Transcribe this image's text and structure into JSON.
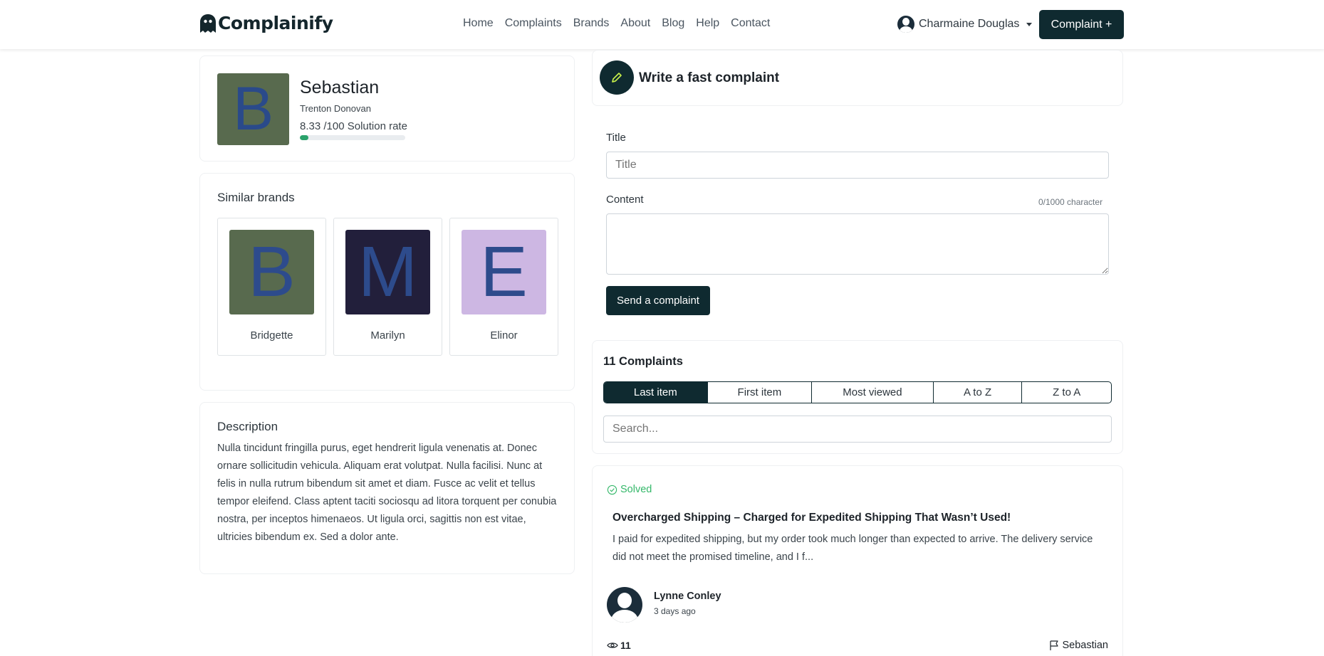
{
  "nav": {
    "logo": "Complainify",
    "links": [
      "Home",
      "Complaints",
      "Brands",
      "About",
      "Blog",
      "Help",
      "Contact"
    ],
    "user": "Charmaine Douglas",
    "cta": "Complaint +"
  },
  "brand": {
    "initial": "B",
    "name": "Sebastian",
    "owner": "Trenton Donovan",
    "rate_text": "8.33 /100 Solution rate",
    "rate_value": 8.33,
    "logo_color": "#586a4e"
  },
  "similar": {
    "title": "Similar brands",
    "items": [
      {
        "initial": "B",
        "name": "Bridgette",
        "color": "#586a4e"
      },
      {
        "initial": "M",
        "name": "Marilyn",
        "color": "#221f3b"
      },
      {
        "initial": "E",
        "name": "Elinor",
        "color": "#cdb7e3"
      }
    ]
  },
  "description": {
    "title": "Description",
    "text": "Nulla tincidunt fringilla purus, eget hendrerit ligula venenatis at. Donec ornare sollicitudin vehicula. Aliquam erat volutpat. Nulla facilisi. Nunc at felis in nulla rutrum bibendum sit amet et diam. Fusce ac velit et tellus tempor eleifend. Class aptent taciti sociosqu ad litora torquent per conubia nostra, per inceptos himenaeos. Ut ligula orci, sagittis non est vitae, ultricies bibendum ex. Sed a dolor ante."
  },
  "write": {
    "title": "Write a fast complaint",
    "title_label": "Title",
    "title_placeholder": "Title",
    "content_label": "Content",
    "char_count": "0/1000 character",
    "submit": "Send a complaint"
  },
  "complaints": {
    "count_label": "11 Complaints",
    "sort_options": [
      "Last item",
      "First item",
      "Most viewed",
      "A to Z",
      "Z to A"
    ],
    "active_sort": "Last item",
    "search_placeholder": "Search...",
    "item": {
      "status": "Solved",
      "title": "Overcharged Shipping – Charged for Expedited Shipping That Wasn’t Used!",
      "text": "I paid for expedited shipping, but my order took much longer than expected to arrive. The delivery service did not meet the promised timeline, and I f...",
      "author": "Lynne Conley",
      "time": "3 days ago",
      "views": "11",
      "brand": "Sebastian"
    }
  },
  "colors": {
    "primary": "#0f2a30",
    "success": "#35b86a",
    "progress": "#2aa26b"
  }
}
